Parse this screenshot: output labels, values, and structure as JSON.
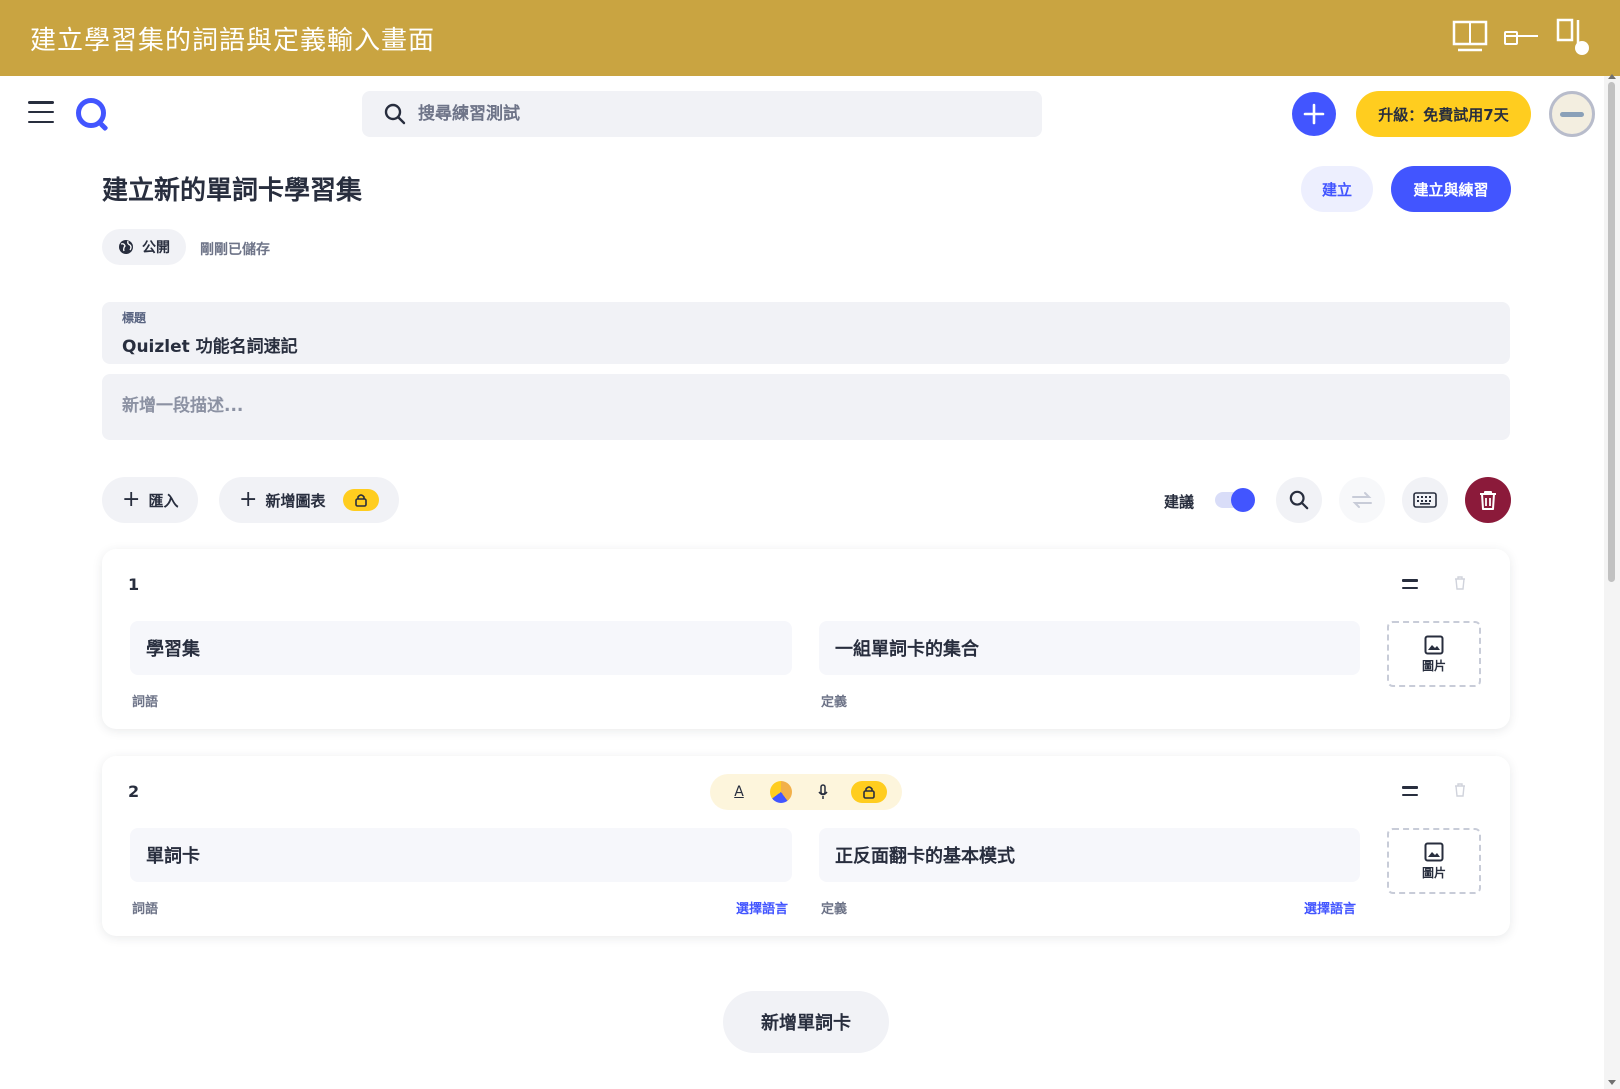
{
  "banner": {
    "title": "建立學習集的詞語與定義輸入畫面"
  },
  "topbar": {
    "search_placeholder": "搜尋練習測試",
    "upgrade_label": "升級：免費試用7天"
  },
  "page": {
    "title": "建立新的單詞卡學習集",
    "create_label": "建立",
    "create_practice_label": "建立與練習",
    "visibility_label": "公開",
    "saved_status": "剛剛已儲存"
  },
  "form": {
    "title_label": "標題",
    "title_value": "Quizlet 功能名詞速記",
    "description_placeholder": "新增一段描述..."
  },
  "toolbar": {
    "import_label": "匯入",
    "add_diagram_label": "新增圖表",
    "suggest_label": "建議",
    "suggest_on": true
  },
  "cards": [
    {
      "number": "1",
      "term": "學習集",
      "definition": "一組單詞卡的集合",
      "term_label": "詞語",
      "definition_label": "定義",
      "image_label": "圖片"
    },
    {
      "number": "2",
      "term": "單詞卡",
      "definition": "正反面翻卡的基本模式",
      "term_label": "詞語",
      "definition_label": "定義",
      "image_label": "圖片",
      "term_lang_link": "選擇語言",
      "definition_lang_link": "選擇語言"
    }
  ],
  "add_card_label": "新增單詞卡",
  "colors": {
    "banner": "#c9a441",
    "primary": "#4255ff",
    "accent_yellow": "#ffcd1f",
    "danger": "#8b1a3a"
  },
  "icons": [
    "menu-icon",
    "quizlet-logo-icon",
    "search-icon",
    "plus-icon",
    "globe-icon",
    "lock-icon",
    "swap-icon",
    "keyboard-icon",
    "trash-icon",
    "image-icon",
    "text-format-icon",
    "color-icon",
    "mic-icon",
    "drag-handle-icon"
  ]
}
